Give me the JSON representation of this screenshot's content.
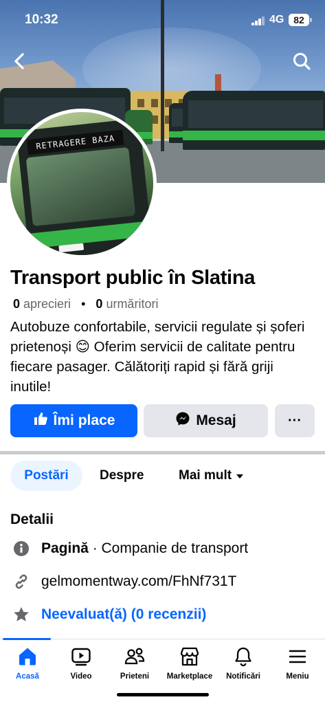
{
  "status_bar": {
    "time": "10:32",
    "network": "4G",
    "battery": "82"
  },
  "cover": {
    "avatar_sign_text": "RETRAGERE BAZA"
  },
  "nav": {
    "back_icon": "chevron-left-icon",
    "search_icon": "search-icon"
  },
  "page": {
    "name": "Transport public în Slatina",
    "likes_count": "0",
    "likes_label": "aprecieri",
    "followers_count": "0",
    "followers_label": "urmăritori",
    "bio": "Autobuze confortabile, servicii regulate și șoferi prietenoși 😊 Oferim servicii de calitate pentru fiecare pasager. Călătoriți rapid și fără griji inutile!"
  },
  "actions": {
    "like_label": "Îmi place",
    "message_label": "Mesaj",
    "more_label": "···"
  },
  "tabs": {
    "posts": "Postări",
    "about": "Despre",
    "more": "Mai mult"
  },
  "details": {
    "title": "Detalii",
    "type_strong": "Pagină",
    "type_rest": " · Companie de transport",
    "link": "gelmomentway.com/FhNf731T",
    "rating": "Neevaluat(ă) (0 recenzii)"
  },
  "bottom_nav": [
    {
      "label": "Acasă",
      "icon": "home-icon",
      "active": true
    },
    {
      "label": "Video",
      "icon": "video-icon",
      "active": false
    },
    {
      "label": "Prieteni",
      "icon": "friends-icon",
      "active": false
    },
    {
      "label": "Marketplace",
      "icon": "marketplace-icon",
      "active": false
    },
    {
      "label": "Notificări",
      "icon": "bell-icon",
      "active": false
    },
    {
      "label": "Meniu",
      "icon": "menu-icon",
      "active": false
    }
  ],
  "colors": {
    "accent": "#0866ff",
    "button_gray": "#e4e6eb",
    "secondary_text": "#65676b"
  }
}
